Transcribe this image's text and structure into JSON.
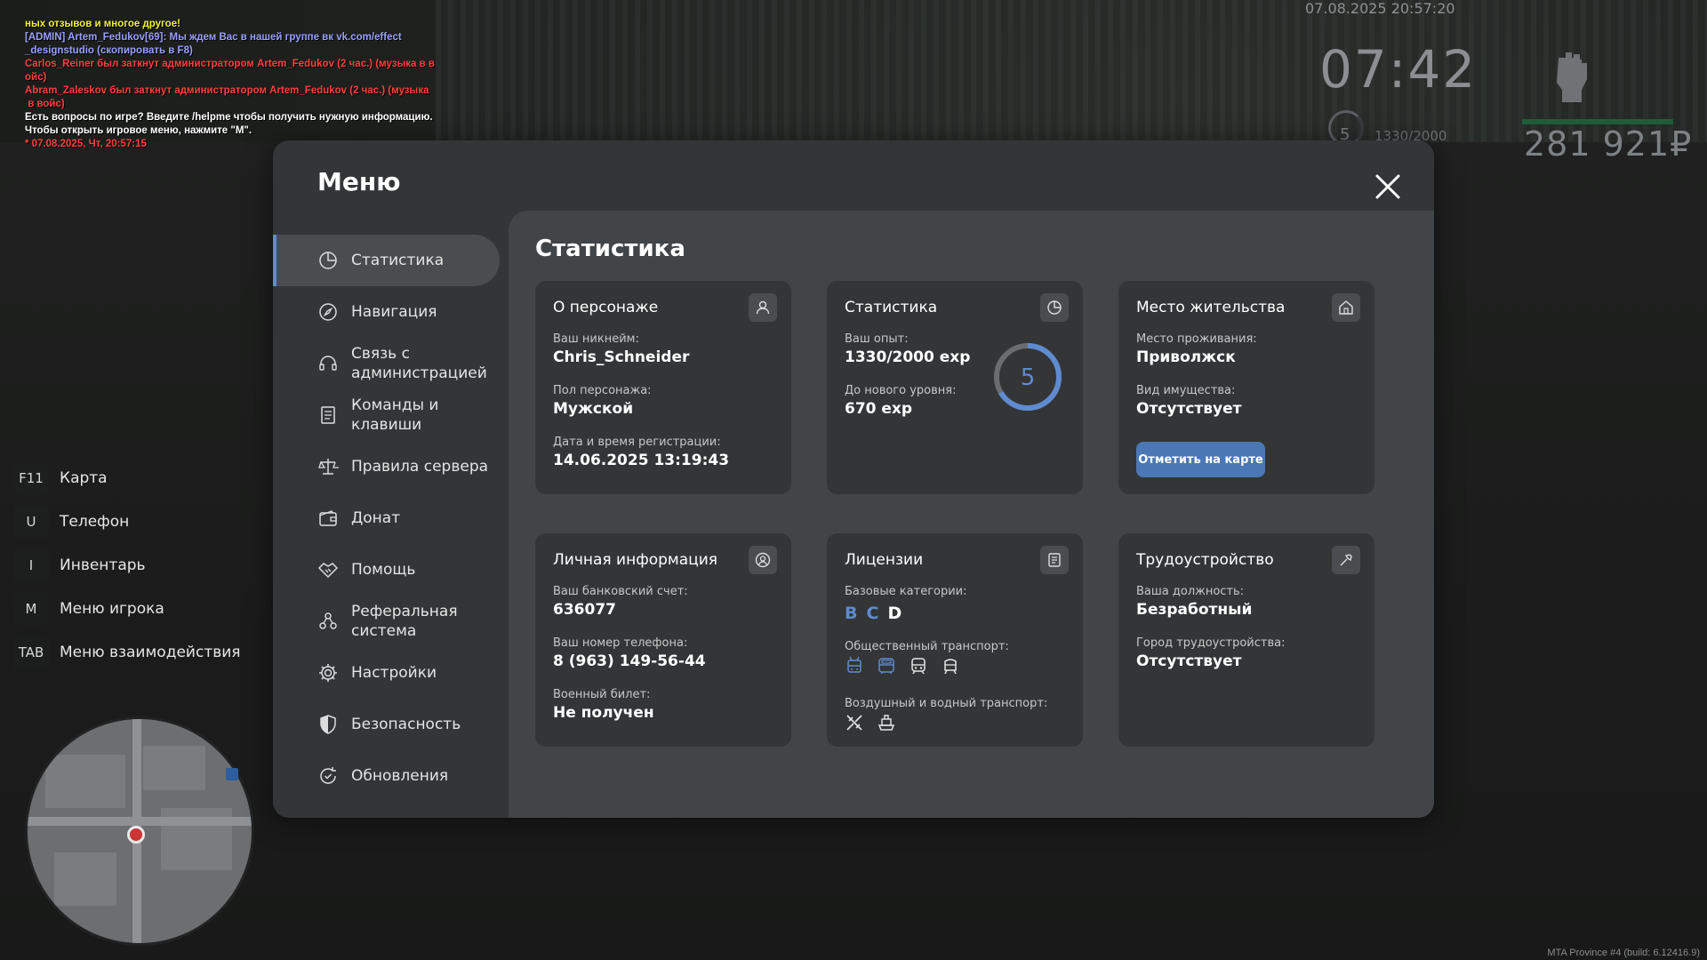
{
  "chat": [
    {
      "text": "ных отзывов и многое другое!",
      "color": "#f2f230"
    },
    {
      "text": "[ADMIN] Artem_Fedukov[69]: Мы ждем Вас в нашей группе вк vk.com/effect",
      "color": "#9aa0ff"
    },
    {
      "text": "_designstudio (скопировать в F8)",
      "color": "#9aa0ff"
    },
    {
      "text": "Carlos_Reiner был заткнут администратором Artem_Fedukov (2 час.) (музыка в в",
      "color": "#ff4040"
    },
    {
      "text": "ойс)",
      "color": "#ff4040"
    },
    {
      "text": "Abram_Zaleskov был заткнут администратором Artem_Fedukov (2 час.) (музыка",
      "color": "#ff4040"
    },
    {
      "text": " в войс)",
      "color": "#ff4040"
    },
    {
      "text": "Есть вопросы по игре? Введите /helpme чтобы получить нужную информацию.",
      "color": "#ffffff"
    },
    {
      "text": "Чтобы открыть игровое меню, нажмите \"M\".",
      "color": "#ffffff"
    },
    {
      "text": "* 07.08.2025, Чт, 20:57:15",
      "color": "#ff4040"
    }
  ],
  "hud": {
    "datetime": "07.08.2025 20:57:20",
    "clock": "07:42",
    "level": "5",
    "xp": "1330/2000",
    "money": "281 921₽",
    "build": "MTA Province #4 (build: 6.12416.9)"
  },
  "hotkeys": [
    {
      "key": "F11",
      "label": "Карта"
    },
    {
      "key": "U",
      "label": "Телефон"
    },
    {
      "key": "I",
      "label": "Инвентарь"
    },
    {
      "key": "M",
      "label": "Меню игрока"
    },
    {
      "key": "TAB",
      "label": "Меню взаимодействия"
    }
  ],
  "menu": {
    "title": "Меню",
    "sidebar": [
      {
        "label": "Статистика",
        "icon": "stats-icon",
        "active": true
      },
      {
        "label": "Навигация",
        "icon": "compass-icon"
      },
      {
        "label": "Связь с администрацией",
        "icon": "headset-icon"
      },
      {
        "label": "Команды и клавиши",
        "icon": "document-icon"
      },
      {
        "label": "Правила сервера",
        "icon": "scales-icon"
      },
      {
        "label": "Донат",
        "icon": "wallet-icon"
      },
      {
        "label": "Помощь",
        "icon": "handshake-icon"
      },
      {
        "label": "Реферальная система",
        "icon": "referral-icon"
      },
      {
        "label": "Настройки",
        "icon": "gear-icon"
      },
      {
        "label": "Безопасность",
        "icon": "shield-icon"
      },
      {
        "label": "Обновления",
        "icon": "refresh-icon"
      }
    ],
    "content_title": "Статистика",
    "cards": {
      "character": {
        "title": "О персонаже",
        "nickname_label": "Ваш никнейм:",
        "nickname": "Chris_Schneider",
        "gender_label": "Пол персонажа:",
        "gender": "Мужской",
        "reg_label": "Дата и время регистрации:",
        "reg": "14.06.2025 13:19:43"
      },
      "stats": {
        "title": "Статистика",
        "xp_label": "Ваш опыт:",
        "xp": "1330/2000 exp",
        "next_label": "До нового уровня:",
        "next": "670 exp",
        "level": "5",
        "level_progress": 0.665
      },
      "residence": {
        "title": "Место жительства",
        "place_label": "Место проживания:",
        "place": "Приволжск",
        "property_label": "Вид имущества:",
        "property": "Отсутствует",
        "button": "Отметить на карте"
      },
      "personal": {
        "title": "Личная информация",
        "bank_label": "Ваш банковский счет:",
        "bank": "636077",
        "phone_label": "Ваш номер телефона:",
        "phone": "8 (963) 149-56-44",
        "military_label": "Военный билет:",
        "military": "Не получен"
      },
      "licenses": {
        "title": "Лицензии",
        "base_label": "Базовые категории:",
        "categories": [
          {
            "name": "B",
            "color": "#5f8bd0"
          },
          {
            "name": "C",
            "color": "#5f8bd0"
          },
          {
            "name": "D",
            "color": "#ffffff"
          }
        ],
        "public_label": "Общественный транспорт:",
        "public_icons": [
          "trolleybus-icon",
          "bus-icon",
          "train-icon",
          "tram-icon"
        ],
        "air_label": "Воздушный и водный транспорт:",
        "air_icons": [
          "plane-icon",
          "boat-icon"
        ]
      },
      "job": {
        "title": "Трудоустройство",
        "position_label": "Ваша должность:",
        "position": "Безработный",
        "city_label": "Город трудоустройства:",
        "city": "Отсутствует"
      }
    }
  },
  "colors": {
    "accent": "#5f8bd0",
    "button": "#4b78b4",
    "panel": "#333536",
    "content": "#424547"
  }
}
